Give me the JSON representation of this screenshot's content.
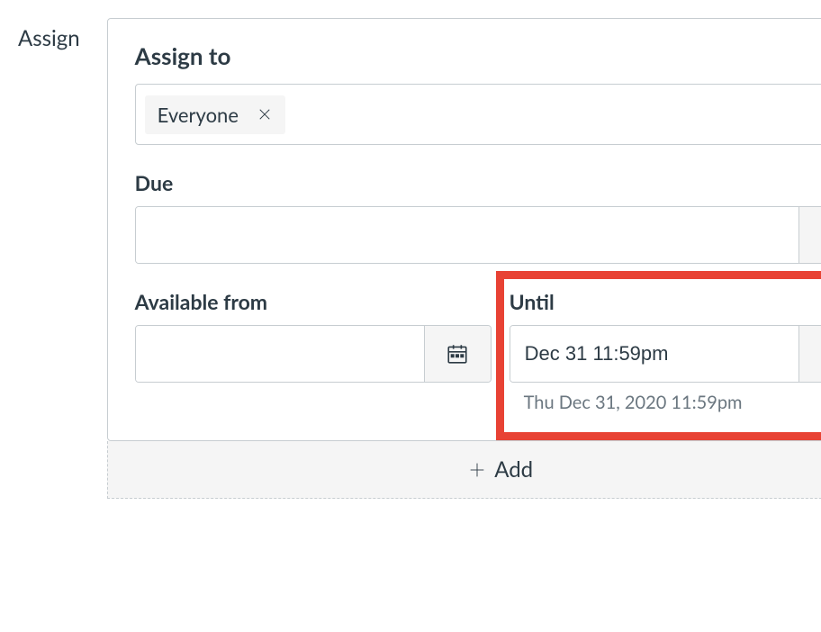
{
  "sideLabel": "Assign",
  "assignTo": {
    "label": "Assign to",
    "tags": [
      {
        "label": "Everyone"
      }
    ]
  },
  "due": {
    "label": "Due",
    "value": "",
    "hint": ""
  },
  "availableFrom": {
    "label": "Available from",
    "value": "",
    "hint": ""
  },
  "until": {
    "label": "Until",
    "value": "Dec 31 11:59pm",
    "hint": "Thu Dec 31, 2020 11:59pm"
  },
  "addLabel": "Add"
}
